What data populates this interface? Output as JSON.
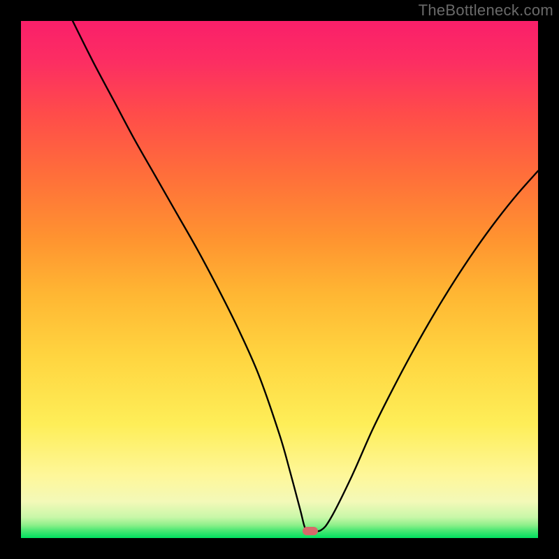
{
  "watermark": "TheBottleneck.com",
  "chart_data": {
    "type": "line",
    "title": "",
    "xlabel": "",
    "ylabel": "",
    "xlim": [
      0,
      100
    ],
    "ylim": [
      0,
      100
    ],
    "x": [
      10,
      14,
      18,
      22,
      26,
      30,
      34,
      38,
      42,
      46,
      50,
      52,
      54,
      55,
      56,
      58,
      60,
      64,
      68,
      72,
      76,
      80,
      84,
      88,
      92,
      96,
      100
    ],
    "y": [
      100,
      92,
      84.5,
      77,
      70,
      63,
      56,
      48.5,
      40.5,
      31.5,
      20,
      13,
      5.5,
      1.8,
      1.5,
      1.5,
      4,
      12,
      21,
      29,
      36.5,
      43.5,
      50,
      56,
      61.5,
      66.5,
      71
    ],
    "plateau_x_range": [
      53,
      58
    ],
    "min_marker": {
      "x": 56,
      "y": 1.3
    },
    "background_gradient": {
      "stops": [
        {
          "pos": 0.0,
          "color": "#00e060"
        },
        {
          "pos": 0.015,
          "color": "#4de874"
        },
        {
          "pos": 0.025,
          "color": "#8df08a"
        },
        {
          "pos": 0.04,
          "color": "#c8f7a8"
        },
        {
          "pos": 0.07,
          "color": "#f3f9b8"
        },
        {
          "pos": 0.12,
          "color": "#fef79a"
        },
        {
          "pos": 0.22,
          "color": "#feee58"
        },
        {
          "pos": 0.35,
          "color": "#ffd540"
        },
        {
          "pos": 0.47,
          "color": "#ffb733"
        },
        {
          "pos": 0.58,
          "color": "#ff9330"
        },
        {
          "pos": 0.7,
          "color": "#ff6f3a"
        },
        {
          "pos": 0.82,
          "color": "#ff4c4a"
        },
        {
          "pos": 0.92,
          "color": "#fc2e62"
        },
        {
          "pos": 1.0,
          "color": "#fa1f6a"
        }
      ]
    }
  }
}
